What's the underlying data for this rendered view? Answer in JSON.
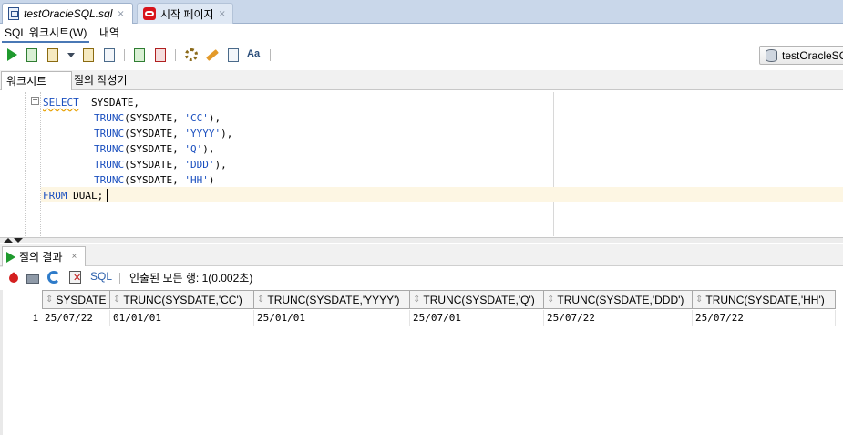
{
  "doc_tabs": [
    {
      "label": "testOracleSQL.sql",
      "close": "×",
      "icon": "sql-file-icon"
    },
    {
      "label": "시작 페이지",
      "close": "×",
      "icon": "oracle-icon"
    }
  ],
  "sub_tabs": [
    "SQL 워크시트(W)",
    "내역"
  ],
  "toolbar": {
    "connection": "testOracleSQL",
    "icons": [
      "run-statement-icon",
      "run-script-icon",
      "autotrace-icon",
      "explain-plan-icon",
      "sql-tuning-icon",
      "commit-icon",
      "rollback-icon",
      "unshared-sql-icon",
      "clear-icon",
      "history-icon",
      "format-icon"
    ]
  },
  "worksheet_tabs": [
    "워크시트",
    "질의 작성기"
  ],
  "editor": {
    "lines": [
      {
        "kw": "SELECT",
        "rest": "  SYSDATE,"
      },
      {
        "fn": "TRUNC",
        "args": "(SYSDATE, ",
        "str": "'CC'",
        "end": "),"
      },
      {
        "fn": "TRUNC",
        "args": "(SYSDATE, ",
        "str": "'YYYY'",
        "end": "),"
      },
      {
        "fn": "TRUNC",
        "args": "(SYSDATE, ",
        "str": "'Q'",
        "end": "),"
      },
      {
        "fn": "TRUNC",
        "args": "(SYSDATE, ",
        "str": "'DDD'",
        "end": "),"
      },
      {
        "fn": "TRUNC",
        "args": "(SYSDATE, ",
        "str": "'HH'",
        "end": ")"
      },
      {
        "kw": "FROM",
        "rest": " DUAL;"
      }
    ],
    "fold_marker": "−"
  },
  "results": {
    "tab_label": "질의 결과",
    "tab_close": "×",
    "sql_link": "SQL",
    "status": "인출된 모든 행: 1(0.002초)",
    "columns": [
      "SYSDATE",
      "TRUNC(SYSDATE,'CC')",
      "TRUNC(SYSDATE,'YYYY')",
      "TRUNC(SYSDATE,'Q')",
      "TRUNC(SYSDATE,'DDD')",
      "TRUNC(SYSDATE,'HH')"
    ],
    "rows": [
      {
        "num": "1",
        "cells": [
          "25/07/22",
          "01/01/01",
          "25/01/01",
          "25/07/01",
          "25/07/22",
          "25/07/22"
        ]
      }
    ]
  }
}
